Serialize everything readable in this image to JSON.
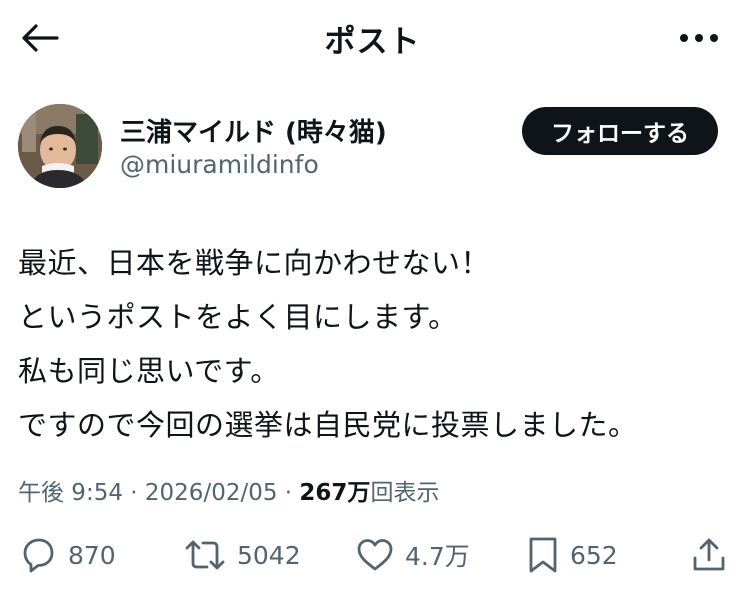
{
  "header": {
    "title": "ポスト",
    "back_icon": "arrow-left-icon",
    "more_icon": "more-horizontal-icon"
  },
  "author": {
    "name": "三浦マイルド (時々猫)",
    "handle": "@miuramildinfo",
    "follow_label": "フォローする"
  },
  "post": {
    "lines": [
      "最近、日本を戦争に向かわせない！",
      "というポストをよく目にします。",
      "私も同じ思いです。",
      "ですので今回の選挙は自民党に投票しました。"
    ]
  },
  "meta": {
    "time": "午後 9:54",
    "sep1": " · ",
    "date": "2026/02/05",
    "sep2": " · ",
    "views": "267万",
    "views_label": "回表示"
  },
  "actions": {
    "reply_count": "870",
    "repost_count": "5042",
    "like_count": "4.7万",
    "bookmark_count": "652"
  },
  "colors": {
    "text": "#0f1419",
    "secondary": "#536471",
    "button_bg": "#0f1419",
    "background": "#ffffff"
  }
}
